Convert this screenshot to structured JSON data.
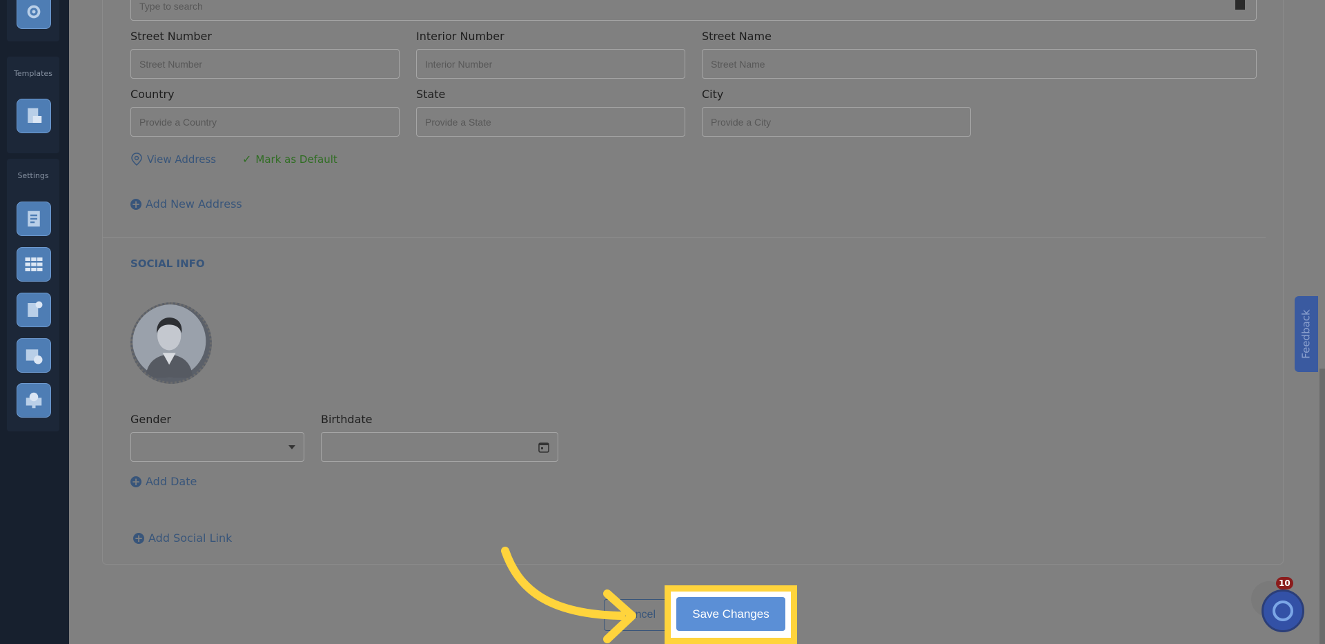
{
  "sidebar": {
    "templates_title": "Templates",
    "settings_title": "Settings",
    "icons": [
      "gear-icon",
      "template-document-icon",
      "report-icon",
      "grid-icon",
      "invoice-icon",
      "calendar-clock-icon",
      "monitor-globe-icon"
    ]
  },
  "address": {
    "search_placeholder": "Type to search",
    "street_number_label": "Street Number",
    "street_number_placeholder": "Street Number",
    "interior_number_label": "Interior Number",
    "interior_number_placeholder": "Interior Number",
    "street_name_label": "Street Name",
    "street_name_placeholder": "Street Name",
    "country_label": "Country",
    "country_placeholder": "Provide a Country",
    "state_label": "State",
    "state_placeholder": "Provide a State",
    "city_label": "City",
    "city_placeholder": "Provide a City",
    "view_address": "View Address",
    "mark_default": "Mark as Default",
    "add_new_address": "Add New Address"
  },
  "social": {
    "title": "SOCIAL INFO",
    "gender_label": "Gender",
    "gender_value": "",
    "birthdate_label": "Birthdate",
    "birthdate_value": "",
    "add_date": "Add Date",
    "add_social_link": "Add Social Link"
  },
  "actions": {
    "cancel_label": "ncel",
    "save_label": "Save Changes"
  },
  "widgets": {
    "feedback_label": "Feedback",
    "notification_count": "10"
  },
  "colors": {
    "highlight": "#ffd43c",
    "save_button": "#5b8fd6",
    "link": "#38557a",
    "sidebar": "#17202e"
  }
}
